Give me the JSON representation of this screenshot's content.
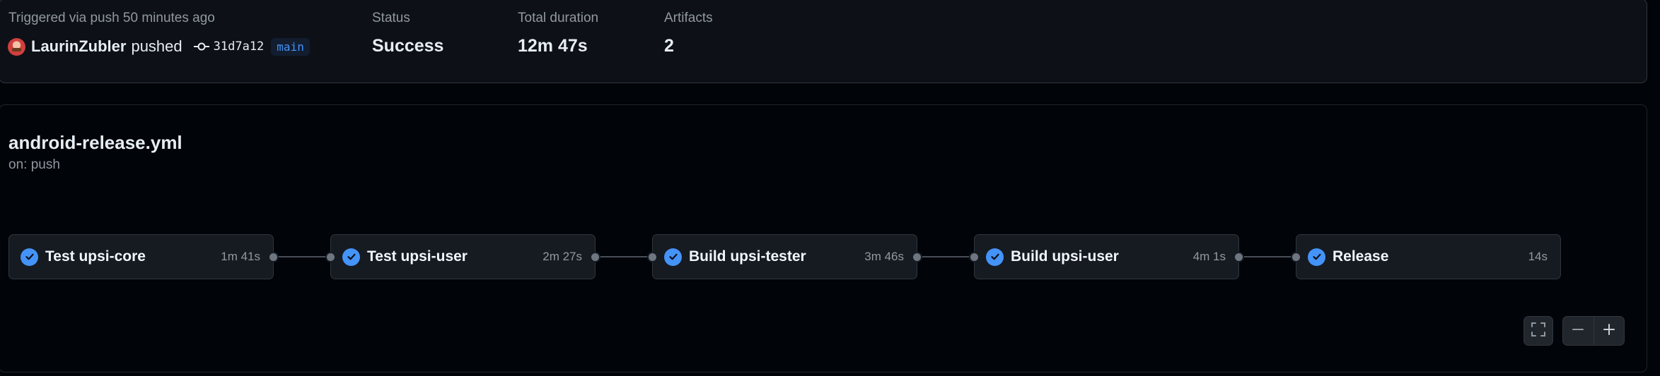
{
  "summary": {
    "triggered_text": "Triggered via push 50 minutes ago",
    "actor": "LaurinZubler",
    "action": "pushed",
    "commit_sha": "31d7a12",
    "branch": "main",
    "status_label": "Status",
    "status_value": "Success",
    "duration_label": "Total duration",
    "duration_value": "12m 47s",
    "artifacts_label": "Artifacts",
    "artifacts_value": "2"
  },
  "workflow": {
    "file_name": "android-release.yml",
    "trigger": "on: push",
    "jobs": [
      {
        "name": "Test upsi-core",
        "duration": "1m 41s",
        "status": "success"
      },
      {
        "name": "Test upsi-user",
        "duration": "2m 27s",
        "status": "success"
      },
      {
        "name": "Build upsi-tester",
        "duration": "3m 46s",
        "status": "success"
      },
      {
        "name": "Build upsi-user",
        "duration": "4m 1s",
        "status": "success"
      },
      {
        "name": "Release",
        "duration": "14s",
        "status": "success"
      }
    ]
  },
  "controls": {
    "fullscreen": "fullscreen-icon",
    "zoom_out": "minus-icon",
    "zoom_in": "plus-icon"
  },
  "colors": {
    "success_check": "#4493f8",
    "branch_text": "#4493f8",
    "background": "#010409",
    "panel": "#0d1117"
  }
}
